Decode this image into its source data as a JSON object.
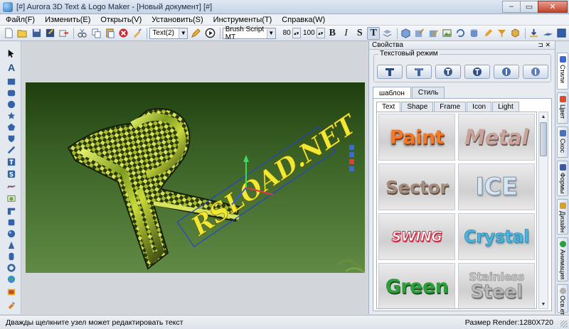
{
  "window": {
    "title": "[#] Aurora 3D Text & Logo Maker - [Новый документ] [#]",
    "minimize_glyph": "–",
    "maximize_glyph": "▭",
    "close_glyph": "✕"
  },
  "menu": [
    "Файл(F)",
    "Изменить(E)",
    "Открыть(V)",
    "Установить(S)",
    "Инструменты(T)",
    "Справка(W)"
  ],
  "toolbar": {
    "text_object": "Text(2)",
    "font_name": "Brush Script MT",
    "font_size": "80",
    "font_weight": "100",
    "bold_label": "B",
    "italic_label": "I",
    "strike_label": "S",
    "text_style_label": "T",
    "dropdown_arrow": "▼"
  },
  "canvas": {
    "logo_text": "RSLOAD.NET",
    "big_letter": "R",
    "colors": {
      "bg_top": "#1e3f0e",
      "bg_bottom": "#608a45",
      "letter": "#c9d93a",
      "text": "#f0e832",
      "selection": "#2a40c8"
    }
  },
  "properties": {
    "title": "Свойства",
    "pin_glyph": "📌",
    "text_mode_label": "Текстовый режим",
    "tabs": [
      "шаблон",
      "Стиль"
    ],
    "subtabs": [
      "Text",
      "Shape",
      "Frame",
      "Icon",
      "Light"
    ],
    "templates": [
      {
        "label": "Paint",
        "color": "#f07a2a"
      },
      {
        "label": "Metal",
        "color": "#c9a29a"
      },
      {
        "label": "Sector",
        "color": "#a58d7e"
      },
      {
        "label": "ICE",
        "color": "#d8e6f2"
      },
      {
        "label": "SWING",
        "color": "#c8344a"
      },
      {
        "label": "Crystal",
        "color": "#4cb6e0"
      },
      {
        "label": "Green",
        "color": "#2e9e3c"
      },
      {
        "label": "Stainless Steel",
        "line1": "Stainless",
        "line2": "Steel",
        "color": "#b9b9b9"
      }
    ]
  },
  "side_tabs": [
    "Стили",
    "Цвет",
    "Скос",
    "Формы",
    "Дизайн",
    "Анимация",
    "Осв.ет"
  ],
  "status": {
    "message": "Дважды щелкните узел может редактировать текст",
    "render_size": "Размер Render:1280X720"
  }
}
